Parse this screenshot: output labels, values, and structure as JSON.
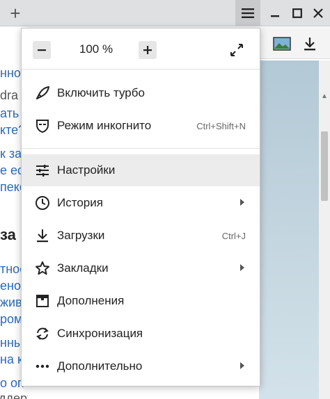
{
  "titlebar": {
    "new_tab_icon": "plus-icon",
    "menu_icon": "hamburger-icon",
    "minimize_icon": "minimize-icon",
    "maximize_icon": "maximize-icon",
    "close_icon": "close-icon"
  },
  "background_page": {
    "snippets": [
      "нно",
      "dra",
      "ать к",
      "кте?",
      "к за",
      "е есл",
      "пекс",
      "за",
      "тное",
      "ено",
      "жив",
      "ром",
      "нны",
      "на к",
      "о оп",
      "ддерживает"
    ]
  },
  "menu": {
    "zoom": {
      "minus": "−",
      "value": "100 %",
      "plus": "+",
      "fullscreen_icon": "fullscreen-icon"
    },
    "items": [
      {
        "label": "Включить турбо",
        "icon": "rocket-icon",
        "shortcut": "",
        "submenu": false
      },
      {
        "label": "Режим инкогнито",
        "icon": "incognito-icon",
        "shortcut": "Ctrl+Shift+N",
        "submenu": false
      },
      {
        "label": "Настройки",
        "icon": "settings-sliders-icon",
        "shortcut": "",
        "submenu": false,
        "highlighted": true
      },
      {
        "label": "История",
        "icon": "clock-icon",
        "shortcut": "",
        "submenu": true
      },
      {
        "label": "Загрузки",
        "icon": "download-icon",
        "shortcut": "Ctrl+J",
        "submenu": false
      },
      {
        "label": "Закладки",
        "icon": "star-icon",
        "shortcut": "",
        "submenu": true
      },
      {
        "label": "Дополнения",
        "icon": "extensions-icon",
        "shortcut": "",
        "submenu": false
      },
      {
        "label": "Синхронизация",
        "icon": "sync-icon",
        "shortcut": "",
        "submenu": false
      },
      {
        "label": "Дополнительно",
        "icon": "more-dots-icon",
        "shortcut": "",
        "submenu": true
      }
    ]
  }
}
